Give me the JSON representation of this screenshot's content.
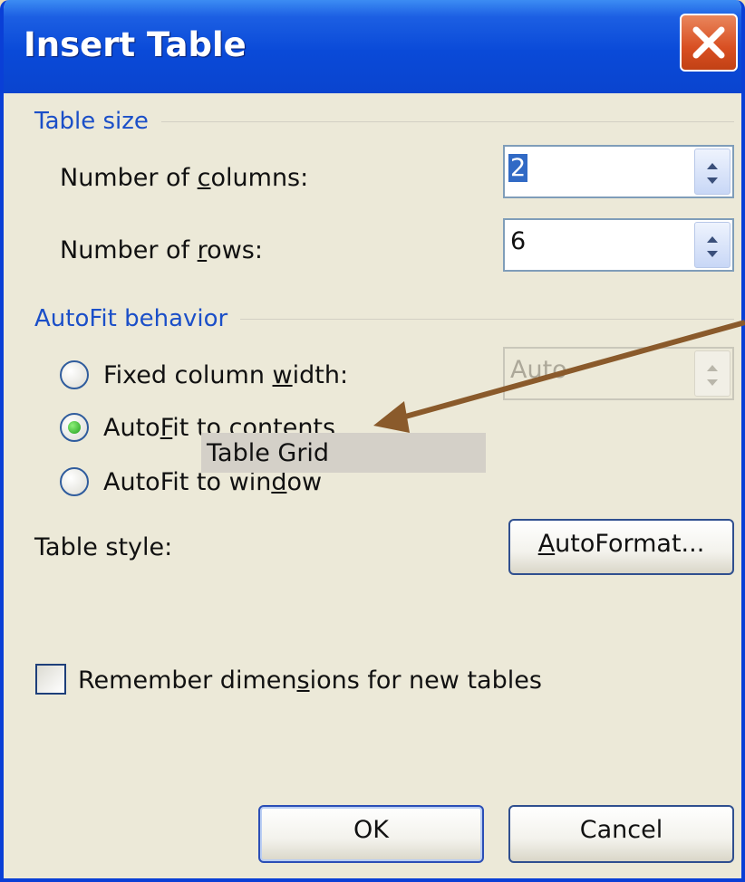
{
  "window": {
    "title": "Insert Table",
    "close_icon": "close-icon"
  },
  "table_size": {
    "heading": "Table size",
    "columns_label_pre": "Number of ",
    "columns_label_key": "c",
    "columns_label_post": "olumns:",
    "columns_value": "2",
    "rows_label_pre": "Number of ",
    "rows_label_key": "r",
    "rows_label_post": "ows:",
    "rows_value": "6"
  },
  "autofit": {
    "heading": "AutoFit behavior",
    "fixed_pre": "Fixed column ",
    "fixed_key": "w",
    "fixed_post": "idth:",
    "fixed_value": "Auto",
    "contents_pre": "Auto",
    "contents_key": "F",
    "contents_post": "it to contents",
    "window_pre": "AutoFit to win",
    "window_key": "d",
    "window_post": "ow",
    "selected": "contents"
  },
  "table_style": {
    "label": "Table style:",
    "value": "Table Grid",
    "autoformat_key": "A",
    "autoformat_rest": "utoFormat..."
  },
  "remember": {
    "pre": "Remember dimen",
    "key": "s",
    "post": "ions for new tables",
    "checked": false
  },
  "buttons": {
    "ok": "OK",
    "cancel": "Cancel"
  },
  "colors": {
    "titlebar": "#0a4ad8",
    "group_heading": "#1b4fc8",
    "annotation_arrow": "#8a5a2b",
    "background": "#f1ddb4"
  }
}
